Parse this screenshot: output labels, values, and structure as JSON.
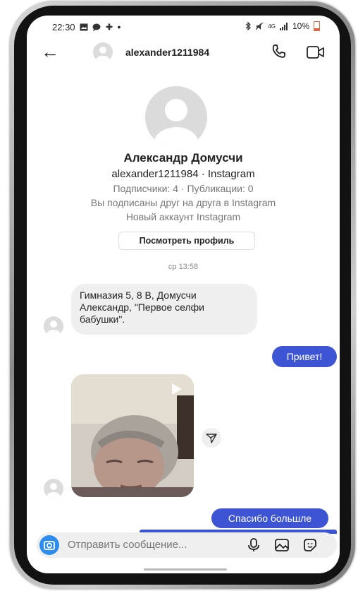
{
  "status_bar": {
    "time": "22:30",
    "left_icons": [
      "gallery-icon",
      "chat-icon",
      "fan-icon",
      "dot"
    ],
    "network": "4G",
    "battery": "10%"
  },
  "header": {
    "username": "alexander1211984"
  },
  "profile": {
    "full_name": "Александр Домусчи",
    "handle_line": "alexander1211984 · Instagram",
    "stats": "Подписчики: 4 · Публикации: 0",
    "mutual": "Вы подписаны друг на друга в Instagram",
    "new_account": "Новый аккаунт Instagram",
    "view_profile_label": "Посмотреть профиль"
  },
  "conversation": {
    "timestamp": "ср 13:58",
    "messages": [
      {
        "direction": "incoming",
        "type": "text",
        "text": "Гимназия 5, 8 В, Домусчи Александр, \"Первое селфи бабушки\"."
      },
      {
        "direction": "outgoing",
        "type": "text",
        "text": "Привет!"
      },
      {
        "direction": "incoming",
        "type": "video"
      },
      {
        "direction": "outgoing",
        "type": "text",
        "text": "Спасибо большле"
      }
    ]
  },
  "composer": {
    "placeholder": "Отправить сообщение..."
  },
  "colors": {
    "outgoing_bubble": "#3d55d4",
    "incoming_bubble": "#efefef",
    "camera_button": "#2d8cf0"
  }
}
